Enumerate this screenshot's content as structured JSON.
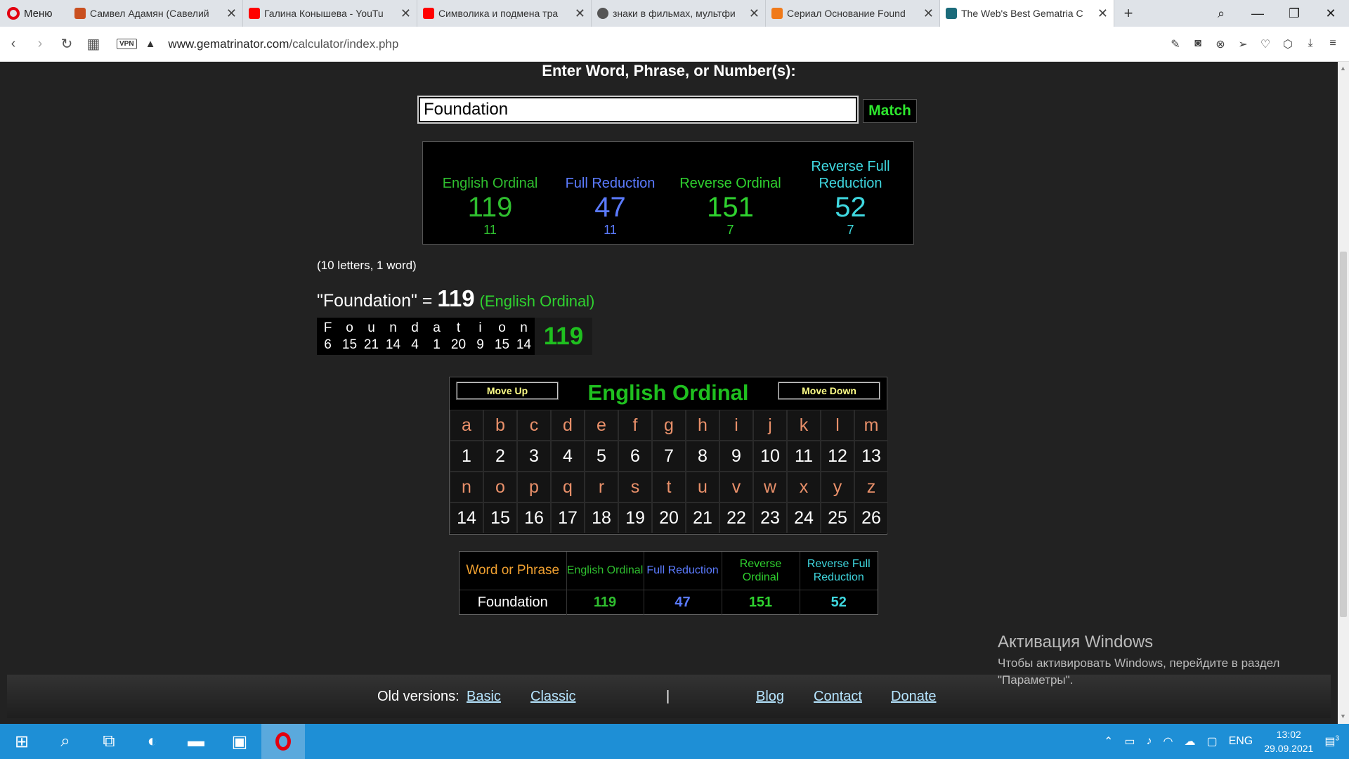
{
  "browser": {
    "menu_label": "Меню",
    "tabs": [
      {
        "title": "Самвел Адамян (Савелий",
        "color": "#c94f1f"
      },
      {
        "title": "Галина Конышева - YouTu",
        "color": "#ff0000"
      },
      {
        "title": "Символика и подмена тра",
        "color": "#ff0000"
      },
      {
        "title": "знаки в фильмах, мультфи",
        "color": "#555555"
      },
      {
        "title": "Сериал Основание Found",
        "color": "#f07a1a"
      },
      {
        "title": "The Web's Best Gematria C",
        "color": "#1b6b7a"
      }
    ],
    "url_domain": "www.gematrinator.com",
    "url_path": "/calculator/index.php",
    "vpn_label": "VPN"
  },
  "page": {
    "heading": "Enter Word, Phrase, or Number(s):",
    "search_value": "Foundation",
    "match_label": "Match",
    "results": [
      {
        "name": "English Ordinal",
        "value": "119",
        "sub": "11",
        "color": "#2fbf2f"
      },
      {
        "name": "Full Reduction",
        "value": "47",
        "sub": "11",
        "color": "#5b7bff"
      },
      {
        "name": "Reverse Ordinal",
        "value": "151",
        "sub": "7",
        "color": "#2fd22f"
      },
      {
        "name": "Reverse Full Reduction",
        "value": "52",
        "sub": "7",
        "color": "#3fd8e0"
      }
    ],
    "letters_info": "(10 letters, 1 word)",
    "equation": {
      "phrase": "\"Foundation\" = ",
      "value": "119",
      "cipher": "(English Ordinal)"
    },
    "breakdown": {
      "letters": [
        "F",
        "o",
        "u",
        "n",
        "d",
        "a",
        "t",
        "i",
        "o",
        "n"
      ],
      "values": [
        "6",
        "15",
        "21",
        "14",
        "4",
        "1",
        "20",
        "9",
        "15",
        "14"
      ],
      "total": "119"
    },
    "cipher_table": {
      "move_up": "Move Up",
      "move_down": "Move Down",
      "title": "English Ordinal",
      "row1_letters": [
        "a",
        "b",
        "c",
        "d",
        "e",
        "f",
        "g",
        "h",
        "i",
        "j",
        "k",
        "l",
        "m"
      ],
      "row1_values": [
        "1",
        "2",
        "3",
        "4",
        "5",
        "6",
        "7",
        "8",
        "9",
        "10",
        "11",
        "12",
        "13"
      ],
      "row2_letters": [
        "n",
        "o",
        "p",
        "q",
        "r",
        "s",
        "t",
        "u",
        "v",
        "w",
        "x",
        "y",
        "z"
      ],
      "row2_values": [
        "14",
        "15",
        "16",
        "17",
        "18",
        "19",
        "20",
        "21",
        "22",
        "23",
        "24",
        "25",
        "26"
      ]
    },
    "summary": {
      "col_word": "Word or Phrase",
      "col_eo": "English Ordinal",
      "col_fr": "Full Reduction",
      "col_ro": "Reverse Ordinal",
      "col_rfr": "Reverse Full Reduction",
      "row_word": "Foundation",
      "row_eo": "119",
      "row_fr": "47",
      "row_ro": "151",
      "row_rfr": "52"
    },
    "footer": {
      "old_versions": "Old versions:",
      "basic": "Basic",
      "classic": "Classic",
      "separator": "|",
      "blog": "Blog",
      "contact": "Contact",
      "donate": "Donate"
    },
    "activation": {
      "title": "Активация Windows",
      "line1": "Чтобы активировать Windows, перейдите в раздел",
      "line2": "\"Параметры\"."
    }
  },
  "taskbar": {
    "lang": "ENG",
    "time": "13:02",
    "date": "29.09.2021",
    "notifications": "3"
  }
}
